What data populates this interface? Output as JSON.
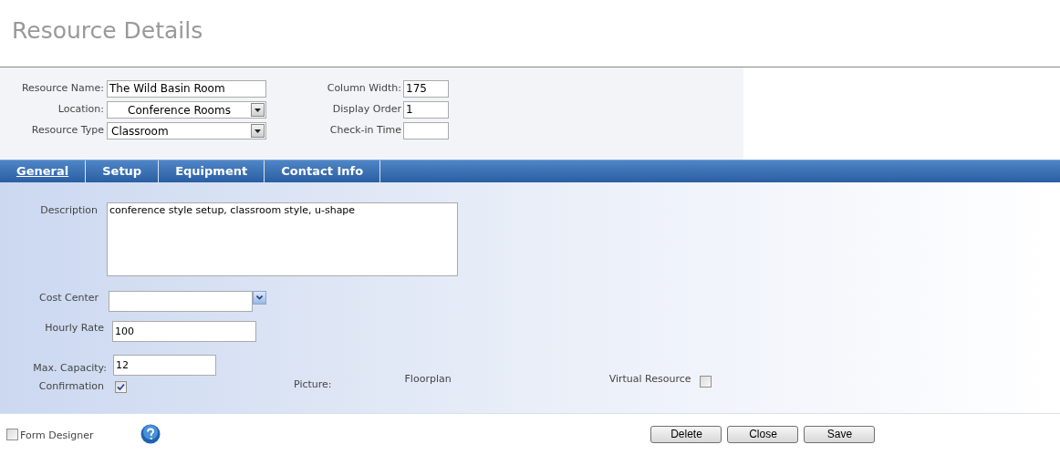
{
  "page_title": "Resource Details",
  "header_fields_left": [
    {
      "kind": "text",
      "label": "Resource Name:",
      "value": "The Wild Basin Room"
    },
    {
      "kind": "select",
      "label": "Location:",
      "value": "Conference Rooms",
      "centered": true
    },
    {
      "kind": "select",
      "label": "Resource Type",
      "value": "Classroom",
      "centered": false
    }
  ],
  "header_fields_right": [
    {
      "label": "Column Width:",
      "value": "175"
    },
    {
      "label": "Display Order",
      "value": "1"
    },
    {
      "label": "Check-in Time"
    }
  ],
  "tabs": [
    {
      "label": "General",
      "selected": true
    },
    {
      "label": "Setup",
      "selected": false
    },
    {
      "label": "Equipment",
      "selected": false
    },
    {
      "label": "Contact Info",
      "selected": false
    }
  ],
  "general": {
    "description": {
      "label": "Description",
      "value": "conference style setup, classroom style, u-shape"
    },
    "cost_center": {
      "label": "Cost Center"
    },
    "hourly_rate": {
      "label": "Hourly Rate",
      "value": "100"
    },
    "max_capacity": {
      "label": "Max. Capacity:",
      "value": "12"
    },
    "confirmation": {
      "label": "Confirmation",
      "checked": true
    },
    "picture": {
      "label": "Picture:",
      "value": "Floorplan"
    },
    "virtual_resource": {
      "label": "Virtual Resource",
      "checked": false
    }
  },
  "footer": {
    "form_designer": {
      "label": "Form Designer",
      "checked": false
    },
    "buttons": [
      "Delete",
      "Close",
      "Save"
    ]
  }
}
